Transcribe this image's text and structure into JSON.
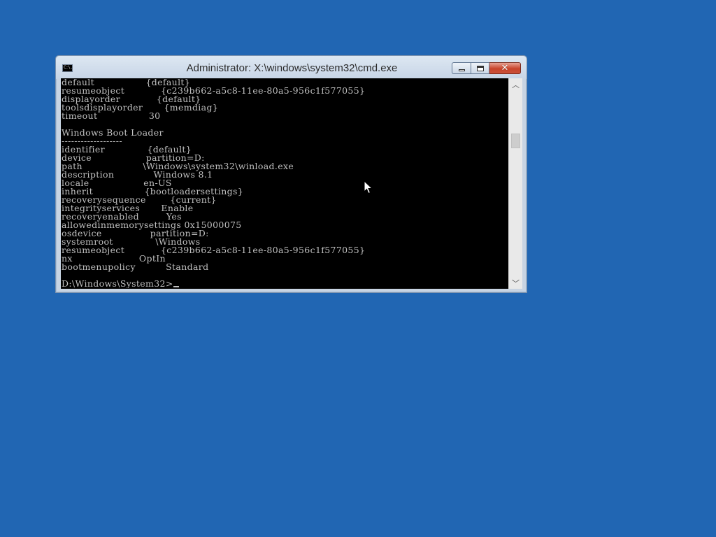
{
  "window": {
    "title": "Administrator: X:\\windows\\system32\\cmd.exe",
    "app_icon_text": "C:\\."
  },
  "caption_buttons": {
    "minimize_icon": "minimize-icon",
    "maximize_icon": "maximize-icon",
    "close_icon": "close-icon",
    "close_glyph": "✕"
  },
  "console": {
    "lines": [
      "default                 {default}",
      "resumeobject            {c239b662-a5c8-11ee-80a5-956c1f577055}",
      "displayorder            {default}",
      "toolsdisplayorder       {memdiag}",
      "timeout                 30",
      "",
      "Windows Boot Loader",
      "-------------------",
      "identifier              {default}",
      "device                  partition=D:",
      "path                    \\Windows\\system32\\winload.exe",
      "description             Windows 8.1",
      "locale                  en-US",
      "inherit                 {bootloadersettings}",
      "recoverysequence        {current}",
      "integrityservices       Enable",
      "recoveryenabled         Yes",
      "allowedinmemorysettings 0x15000075",
      "osdevice                partition=D:",
      "systemroot              \\Windows",
      "resumeobject            {c239b662-a5c8-11ee-80a5-956c1f577055}",
      "nx                      OptIn",
      "bootmenupolicy          Standard",
      ""
    ],
    "prompt": "D:\\Windows\\System32>"
  },
  "scrollbar": {
    "up_glyph": "︿",
    "down_glyph": "﹀"
  },
  "colors": {
    "desktop": "#2166b3",
    "console_bg": "#000000",
    "console_text": "#c0c0c0",
    "close_button": "#c8432b"
  }
}
